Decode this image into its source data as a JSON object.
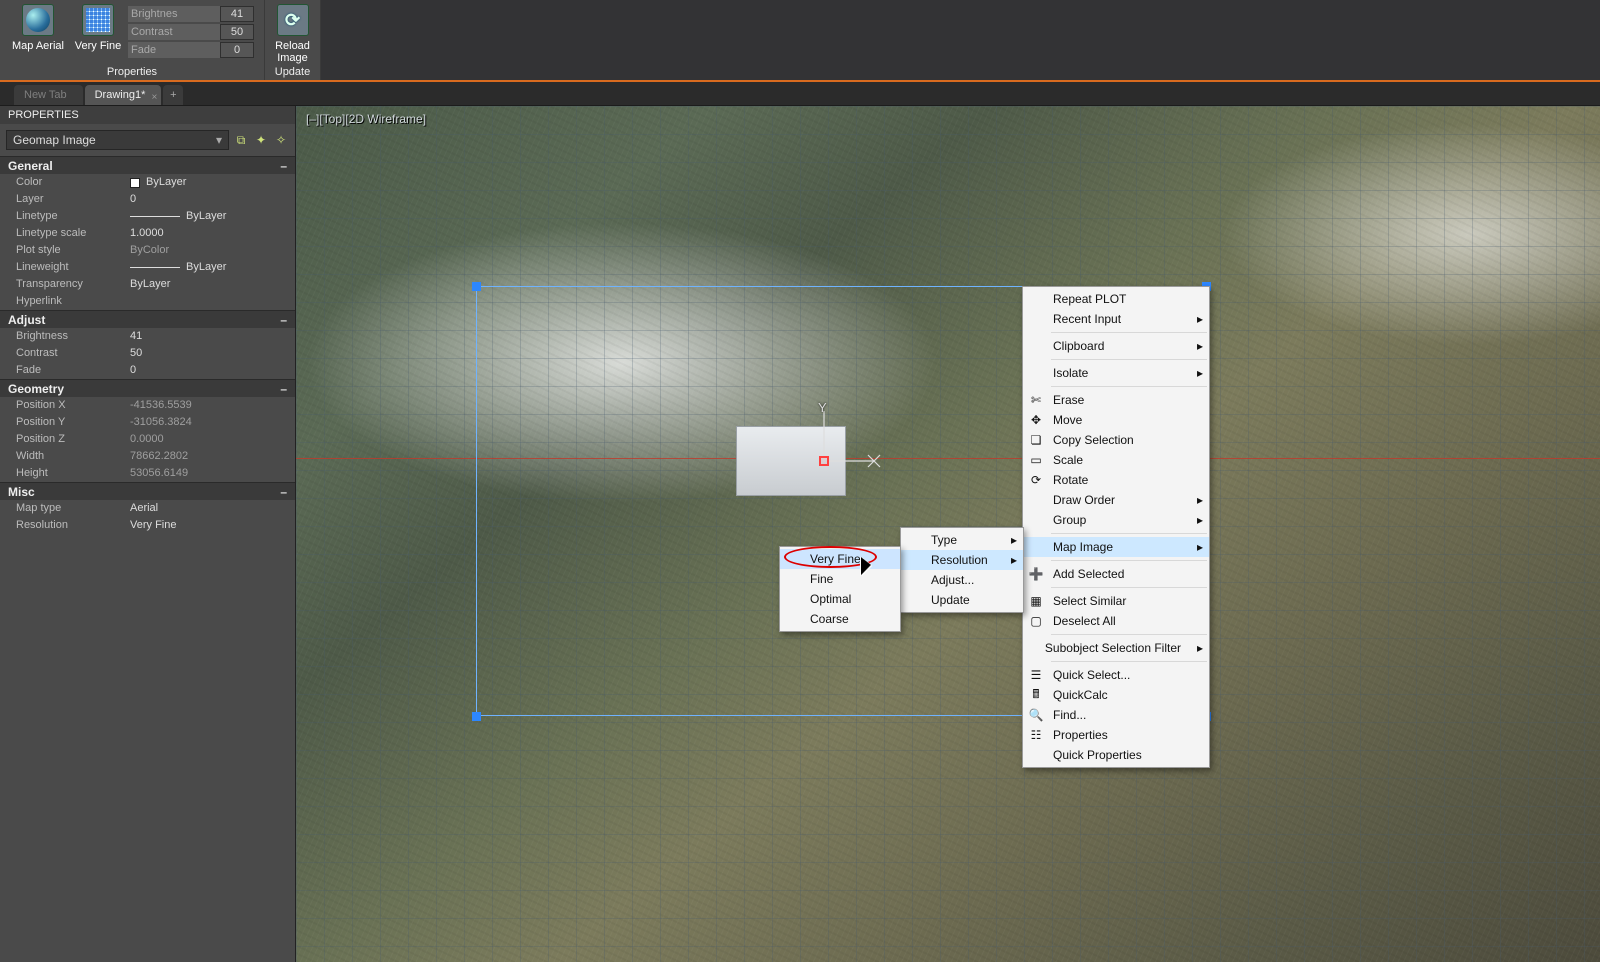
{
  "ribbon": {
    "map_aerial": "Map Aerial",
    "very_fine": "Very Fine",
    "brightness_lbl": "Brightness",
    "brightness_val": "41",
    "contrast_lbl": "Contrast",
    "contrast_val": "50",
    "fade_lbl": "Fade",
    "fade_val": "0",
    "properties_title": "Properties",
    "reload_image": "Reload\nImage",
    "reload_l1": "Reload",
    "reload_l2": "Image",
    "update_title": "Update"
  },
  "tabs": {
    "new": "New Tab",
    "active": "Drawing1*"
  },
  "props": {
    "title": "PROPERTIES",
    "selector": "Geomap Image",
    "sections": {
      "general": {
        "title": "General",
        "rows": {
          "color_lbl": "Color",
          "color_val": "ByLayer",
          "layer_lbl": "Layer",
          "layer_val": "0",
          "linetype_lbl": "Linetype",
          "linetype_val": "ByLayer",
          "lscale_lbl": "Linetype scale",
          "lscale_val": "1.0000",
          "plot_lbl": "Plot style",
          "plot_val": "ByColor",
          "lweight_lbl": "Lineweight",
          "lweight_val": "ByLayer",
          "trans_lbl": "Transparency",
          "trans_val": "ByLayer",
          "hyper_lbl": "Hyperlink",
          "hyper_val": ""
        }
      },
      "adjust": {
        "title": "Adjust",
        "rows": {
          "brightness_lbl": "Brightness",
          "brightness_val": "41",
          "contrast_lbl": "Contrast",
          "contrast_val": "50",
          "fade_lbl": "Fade",
          "fade_val": "0"
        }
      },
      "geometry": {
        "title": "Geometry",
        "rows": {
          "px_lbl": "Position X",
          "px_val": "-41536.5539",
          "py_lbl": "Position Y",
          "py_val": "-31056.3824",
          "pz_lbl": "Position Z",
          "pz_val": "0.0000",
          "w_lbl": "Width",
          "w_val": "78662.2802",
          "h_lbl": "Height",
          "h_val": "53056.6149"
        }
      },
      "misc": {
        "title": "Misc",
        "rows": {
          "maptype_lbl": "Map type",
          "maptype_val": "Aerial",
          "res_lbl": "Resolution",
          "res_val": "Very Fine"
        }
      }
    }
  },
  "viewport": {
    "label": "[–][Top][2D Wireframe]",
    "axis_y": "Y",
    "axis_x": "X"
  },
  "cmenu_main": {
    "repeat": "Repeat PLOT",
    "recent": "Recent Input",
    "clipboard": "Clipboard",
    "isolate": "Isolate",
    "erase": "Erase",
    "move": "Move",
    "copy": "Copy Selection",
    "scale": "Scale",
    "rotate": "Rotate",
    "draworder": "Draw Order",
    "group": "Group",
    "mapimage": "Map Image",
    "addselected": "Add Selected",
    "selectsimilar": "Select Similar",
    "deselect": "Deselect All",
    "subfilter": "Subobject Selection Filter",
    "quickselect": "Quick Select...",
    "quickcalc": "QuickCalc",
    "find": "Find...",
    "properties": "Properties",
    "quickprops": "Quick Properties"
  },
  "cmenu_mapimage": {
    "type": "Type",
    "resolution": "Resolution",
    "adjust": "Adjust...",
    "update": "Update"
  },
  "cmenu_res": {
    "veryfine": "Very Fine",
    "fine": "Fine",
    "optimal": "Optimal",
    "coarse": "Coarse"
  }
}
